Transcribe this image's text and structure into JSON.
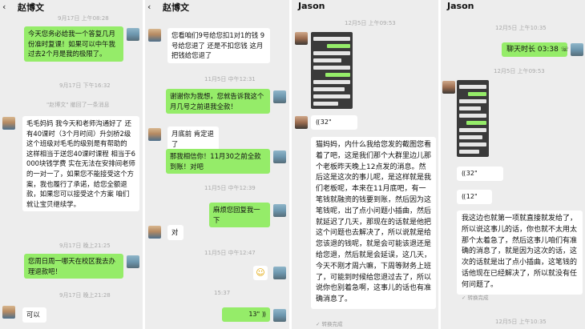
{
  "panel1": {
    "title": "赵博文",
    "back_icon": "chevron-left-icon",
    "time1": "9月17日 上午08:28",
    "msg1": "今天您务必给我一个答复几月份准时复课！如果可以中午我过去2个月是我的极限了。",
    "time2": "9月17日 下午16:32",
    "recall": "\"赵博文\" 撤回了一条消息",
    "msg2": "毛毛妈妈 我今天和老师沟通好了 还有40课时（3个月时间）升剑桥2级 这个班级对毛毛的级别是有帮助的 这样相当于送您40课时课程 相当于6000块钱学费 实在无法在安排间老师的一对一了，如果您不能接受这个方案，我也履行了承诺，给您全额退款，如果您可以接受这个方案 咱们就让宝贝继续学。",
    "time3": "9月17日 晚上21:25",
    "msg3": "您周日周一哪天在校区我去办理退款吧！",
    "time4": "9月17日 晚上21:28",
    "msg4": "可以"
  },
  "panel2": {
    "title": "赵博文",
    "back_icon": "chevron-left-icon",
    "msg1": "您看咱们9号给您扣1对1的钱 9号给您退了 还是不扣您钱 这月把钱给您退了",
    "time1": "11月5日 中午12:31",
    "msg2": "谢谢你为我想，您就告诉我这个月几号之前退我全款！",
    "msg3": "月底前 肯定退了",
    "msg4": "那我相信你！11月30之前全款到账！对吧",
    "time2": "11月5日 中午12:39",
    "msg5": "麻烦您回复我一下",
    "msg6": "对",
    "time3": "11月5日 中午12:47",
    "time4": "15:37",
    "voice1": "13\""
  },
  "panel3": {
    "title": "Jason",
    "time1": "12月5日 上午09:53",
    "voice1": "32\"",
    "msg1": "猫妈妈，内什么我给您发的截图您看着了吧，这是我们那个大群里边儿那个老板昨天晚上12点发的消息。然后这是这次的事儿呢，是这样就是我们老板呢，本来在11月底吧，有一笔钱就融资的钱要到账，然后因为这笔钱呢，出了点小问题小插曲，然后就延迟了几天，那现在的话就是他把这个问题也去解决了，所以说就是给您该退的钱呢，就是会可能该退还是给您退，然后就是会延误，这几天，今天不刚才周六嘛，下周等财务上班了，可能到时候给您退过去了，所以说你也别着急啊，这事儿的话也有准确消息了。",
    "convert": "转换完成"
  },
  "panel4": {
    "title": "Jason",
    "time1": "12月5日 上午10:35",
    "call": "聊天时长 03:38",
    "time2": "12月5日 上午09:53",
    "voice1": "32\"",
    "voice2": "12\"",
    "msg1": "我这边也就第一项就直接就发给了，所以说这事儿的话，你也就不太用太那个太着急了，然后这事儿咱们有准确的消息了，就是因为这次的话，这次的话就是出了点小插曲，这笔钱的话他现在已经解决了，所以就没有任何问题了。",
    "convert": "转换完成",
    "time3": "12月5日 上午10:35"
  }
}
